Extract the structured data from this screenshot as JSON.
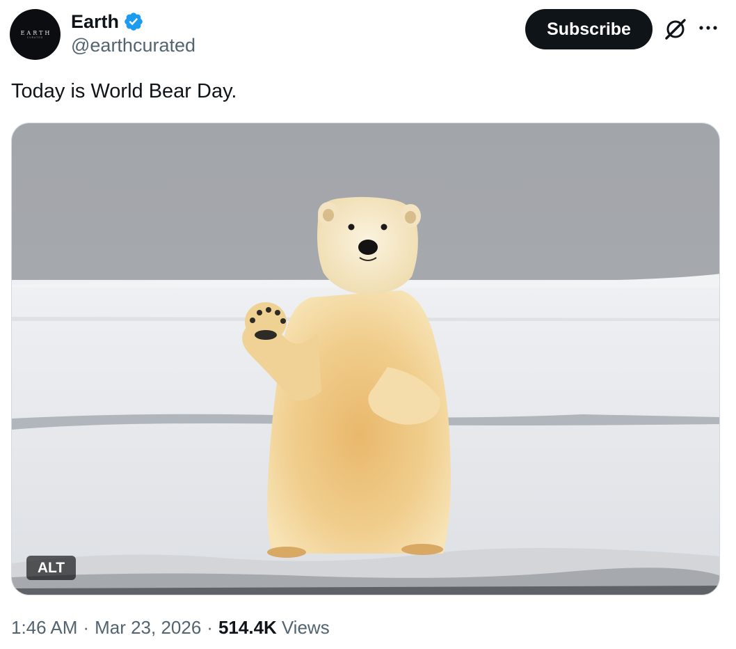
{
  "account": {
    "display_name": "Earth",
    "handle": "@earthcurated",
    "avatar_text": "EARTH",
    "avatar_subtext": "CURATED",
    "verified_color": "#1d9bf0"
  },
  "actions": {
    "subscribe_label": "Subscribe",
    "grok_icon": "grok-icon",
    "more_icon": "more-options-icon"
  },
  "tweet": {
    "text": "Today is World Bear Day.",
    "media": {
      "subject": "polar bear waving on snow",
      "alt_badge": "ALT"
    }
  },
  "meta": {
    "time": "1:46 AM",
    "separator": "·",
    "date": "Mar 23, 2026",
    "views_count": "514.4K",
    "views_label": "Views"
  },
  "colors": {
    "primary_text": "#0f1419",
    "secondary_text": "#536471",
    "button_bg": "#0f1419",
    "verified_blue": "#1d9bf0"
  }
}
